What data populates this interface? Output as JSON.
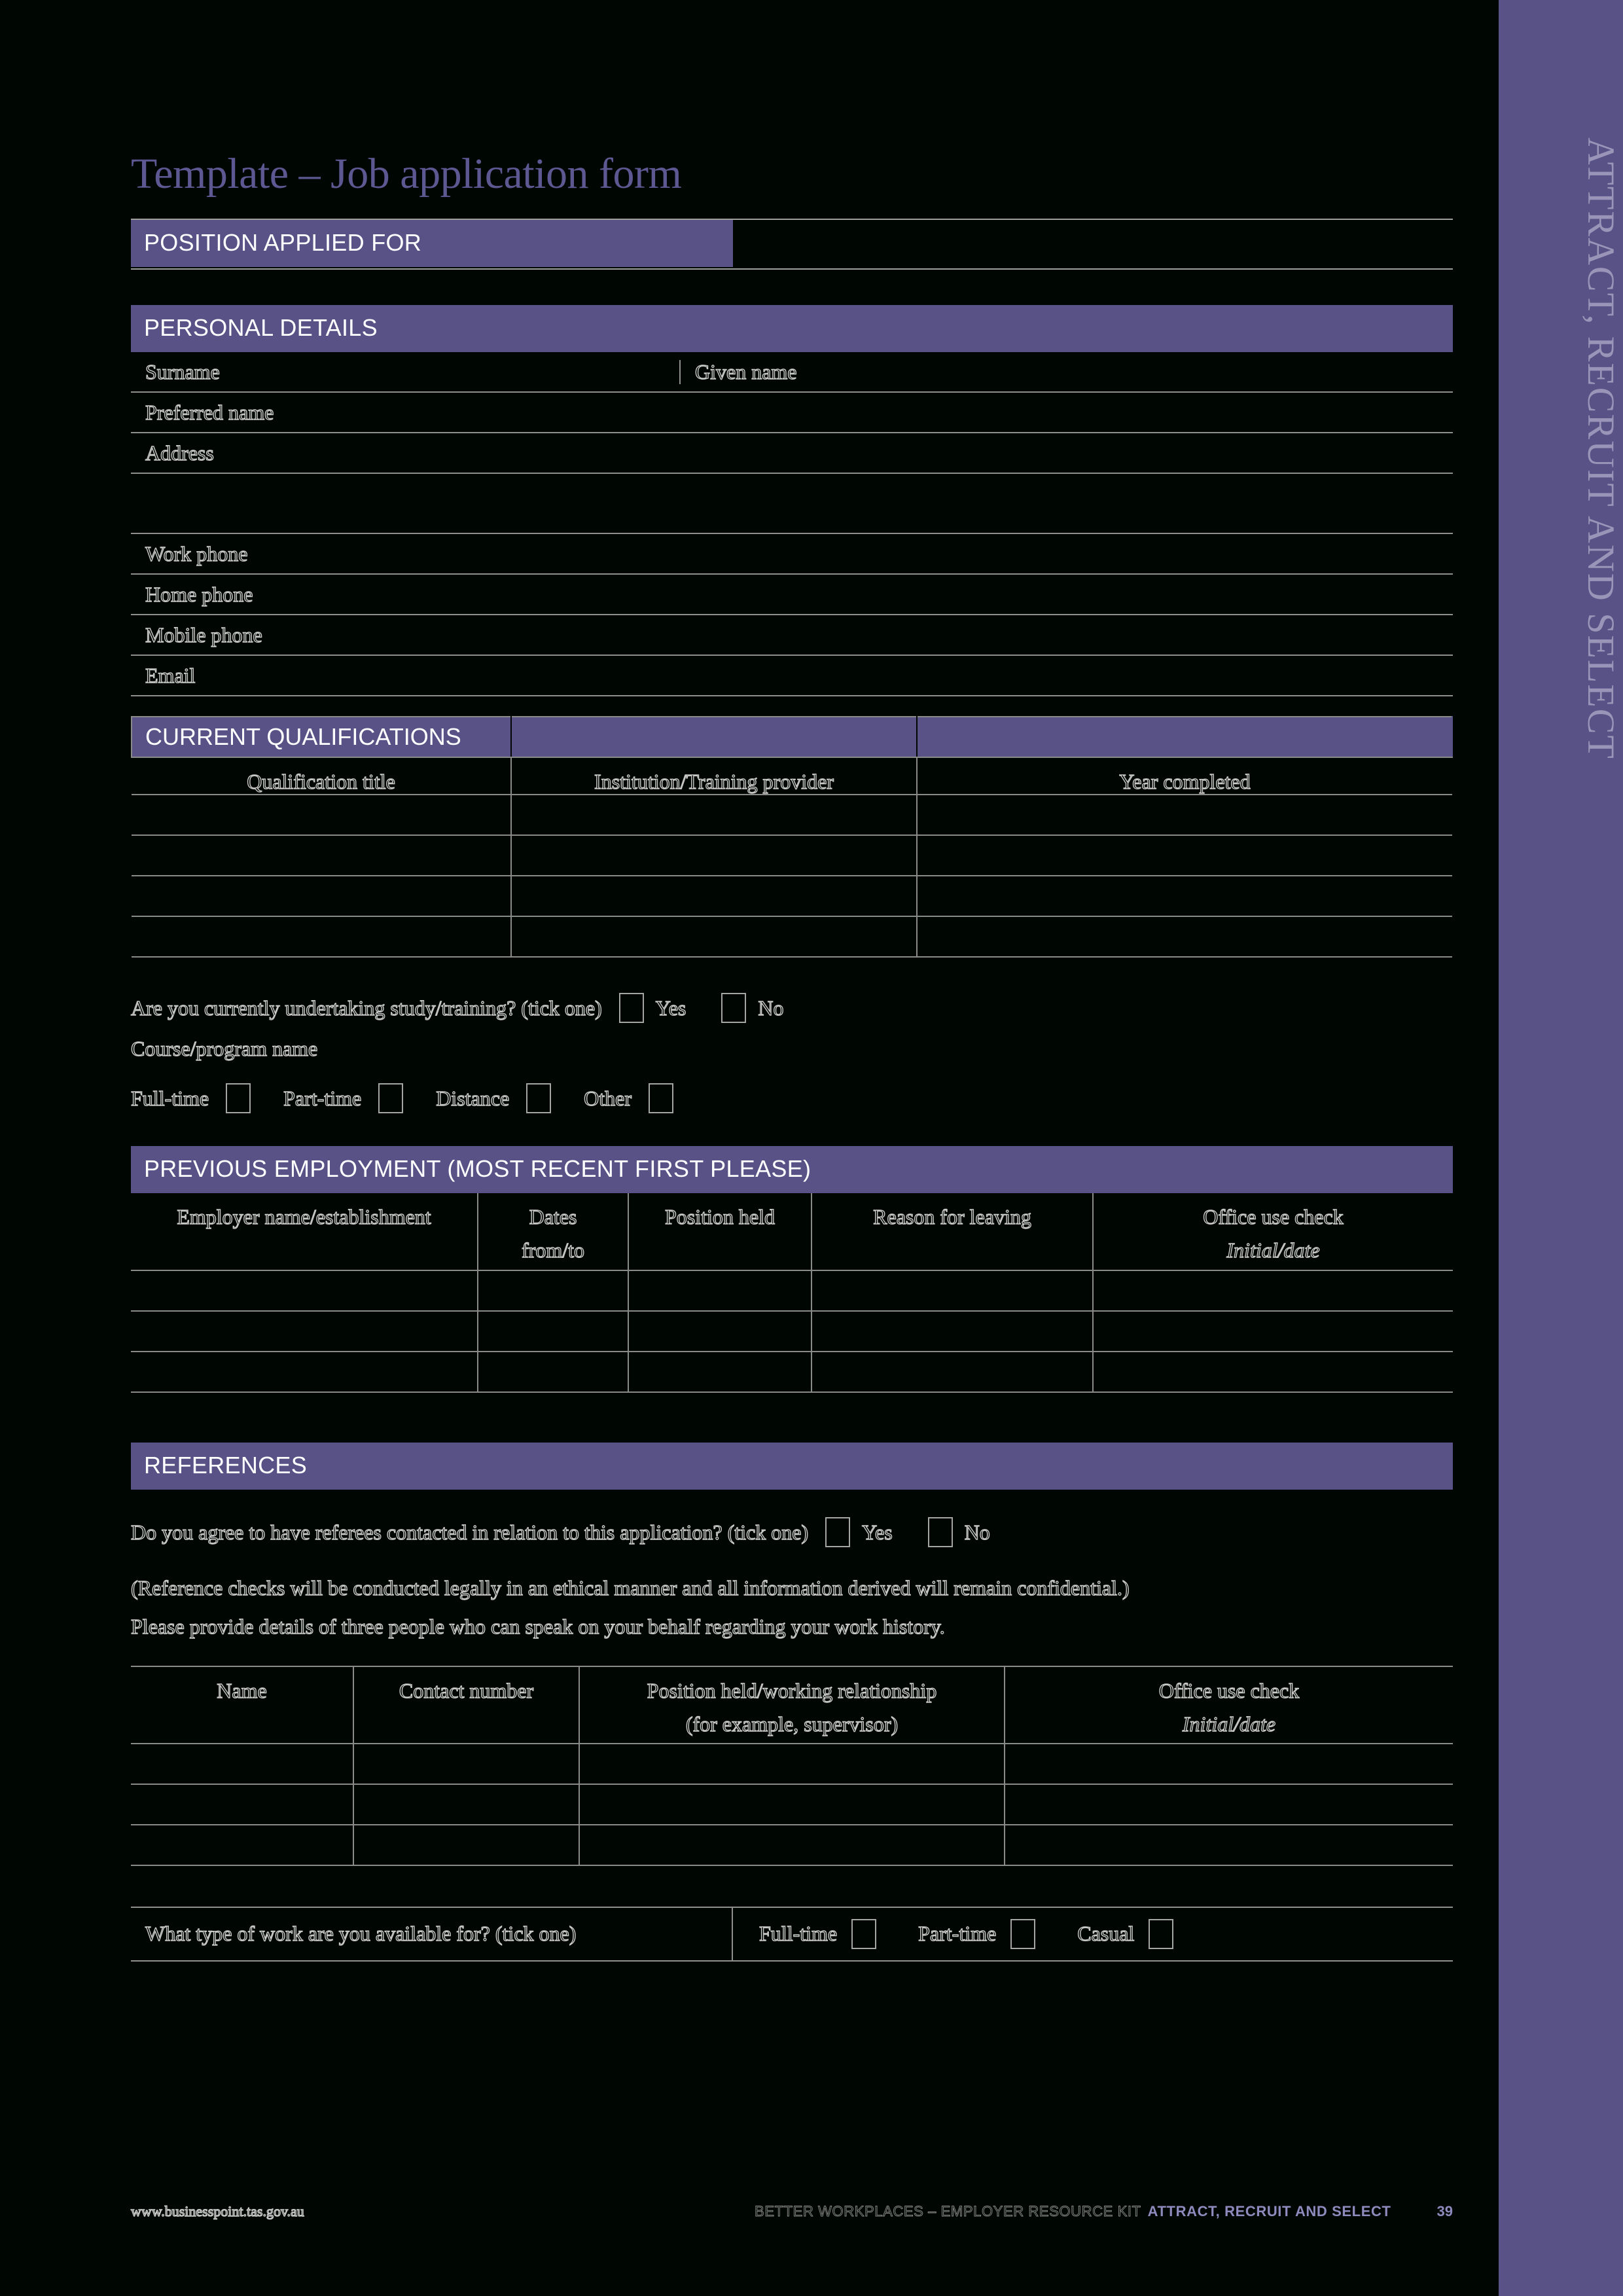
{
  "side_band": {
    "label": "ATTRACT, RECRUIT AND SELECT"
  },
  "title": "Template – Job application form",
  "position_applied": {
    "label": "POSITION APPLIED FOR",
    "value": ""
  },
  "personal_details": {
    "heading": "PERSONAL DETAILS",
    "surname_label": "Surname",
    "given_name_label": "Given name",
    "preferred_name_label": "Preferred name",
    "address_label": "Address",
    "address_blank_label": "",
    "work_phone_label": "Work phone",
    "home_phone_label": "Home phone",
    "mobile_phone_label": "Mobile phone",
    "email_label": "Email"
  },
  "qualifications": {
    "heading": "CURRENT QUALIFICATIONS",
    "columns": [
      "Qualification title",
      "Institution/Training provider",
      "Year completed"
    ],
    "rows": [
      [
        "",
        "",
        ""
      ],
      [
        "",
        "",
        ""
      ],
      [
        "",
        "",
        ""
      ],
      [
        "",
        "",
        ""
      ]
    ],
    "study_question": "Are you currently undertaking study/training? (tick one)",
    "yes_label": "Yes",
    "no_label": "No",
    "course_label": "Course/program name",
    "mode_options": [
      "Full-time",
      "Part-time",
      "Distance",
      "Other"
    ]
  },
  "previous_employment": {
    "heading": "PREVIOUS EMPLOYMENT (MOST RECENT FIRST PLEASE)",
    "columns": [
      {
        "main": "Employer name/establishment",
        "sub": ""
      },
      {
        "main": "Dates",
        "sub": "from/to"
      },
      {
        "main": "Position held",
        "sub": ""
      },
      {
        "main": "Reason for leaving",
        "sub": ""
      },
      {
        "main": "Office use check",
        "sub": "Initial/date"
      }
    ],
    "rows": [
      [
        "",
        "",
        "",
        "",
        ""
      ],
      [
        "",
        "",
        "",
        "",
        ""
      ],
      [
        "",
        "",
        "",
        "",
        ""
      ]
    ]
  },
  "references": {
    "heading": "REFERENCES",
    "consent_question": "Do you agree to have referees contacted in relation to this application? (tick one)",
    "yes_label": "Yes",
    "no_label": "No",
    "note_line_1": "(Reference checks will be conducted legally in an ethical manner and all information derived will remain confidential.)",
    "note_line_2": "Please provide details of three people who can speak on your behalf regarding your work history.",
    "columns": [
      {
        "main": "Name",
        "sub": ""
      },
      {
        "main": "Contact number",
        "sub": ""
      },
      {
        "main": "Position held/working relationship",
        "sub": "(for example, supervisor)"
      },
      {
        "main": "Office use check",
        "sub": "Initial/date"
      }
    ],
    "rows": [
      [
        "",
        "",
        "",
        ""
      ],
      [
        "",
        "",
        "",
        ""
      ],
      [
        "",
        "",
        "",
        ""
      ]
    ]
  },
  "availability": {
    "question": "What type of work are you available for? (tick one)",
    "options": [
      "Full-time",
      "Part-time",
      "Casual"
    ]
  },
  "footer": {
    "url": "www.businesspoint.tas.gov.au",
    "kit": "BETTER WORKPLACES – EMPLOYER RESOURCE KIT",
    "section": "ATTRACT, RECRUIT AND SELECT",
    "page": "39"
  },
  "colors": {
    "purple": "#585286",
    "purple_light": "#9a95b8",
    "background": "#000702",
    "rule": "#8f8f8f"
  }
}
